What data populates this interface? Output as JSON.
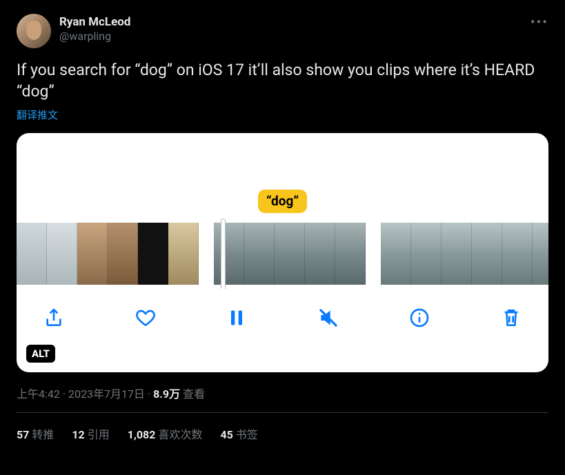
{
  "author": {
    "display_name": "Ryan McLeod",
    "handle": "@warpling"
  },
  "tweet_text": "If you search for “dog” on iOS 17 it’ll also show you clips where it’s HEARD “dog”",
  "translate_label": "翻译推文",
  "media": {
    "bubble_text": "“dog”",
    "alt_badge": "ALT"
  },
  "meta": {
    "time": "上午4:42",
    "sep1": " · ",
    "date": "2023年7月17日",
    "sep2": " · ",
    "views_count": "8.9万",
    "views_label": " 查看"
  },
  "stats": {
    "retweets_count": "57",
    "retweets_label": "转推",
    "quotes_count": "12",
    "quotes_label": "引用",
    "likes_count": "1,082",
    "likes_label": "喜欢次数",
    "bookmarks_count": "45",
    "bookmarks_label": "书签"
  }
}
